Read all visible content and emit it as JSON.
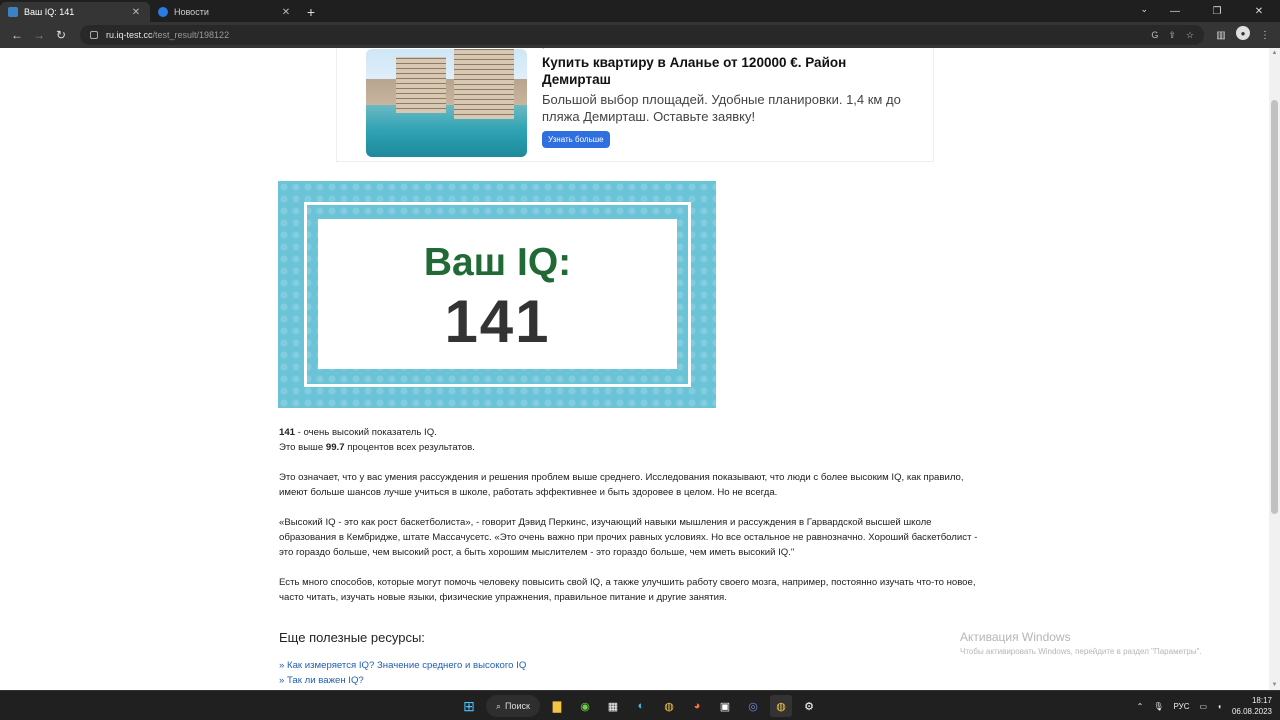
{
  "browser": {
    "tabs": [
      {
        "label": "Ваш IQ: 141",
        "active": true,
        "favicon_color": "#3b82c4"
      },
      {
        "label": "Новости",
        "active": false,
        "favicon_color": "#2a7be4"
      }
    ],
    "url_host": "ru.iq-test.cc",
    "url_path": "/test_result/198122"
  },
  "ad": {
    "title": "Купить квартиру в Аланье от 120000 €. Район Демирташ",
    "description": "Большой выбор площадей. Удобные планировки. 1,4 км до пляжа Демирташ. Оставьте заявку!",
    "button_label": "Узнать больше"
  },
  "result": {
    "label": "Ваш IQ:",
    "value": "141"
  },
  "article": {
    "p1_score": "141",
    "p1_text": " - очень высокий показатель IQ.",
    "p1_line2_prefix": "Это выше ",
    "p1_percent": "99.7",
    "p1_line2_suffix": " процентов всех результатов.",
    "p2": "Это означает, что у вас умения рассуждения и решения проблем выше среднего. Исследования показывают, что люди с более высоким IQ, как правило, имеют больше шансов лучше учиться в школе, работать эффективнее и быть здоровее в целом. Но не всегда.",
    "p3": "«Высокий IQ - это как рост баскетболиста», - говорит Дэвид Перкинс, изучающий навыки мышления и рассуждения в Гарвардской высшей школе образования в Кембридже, штате Массачусетс. «Это очень важно при прочих равных условиях. Но все остальное не равнозначно. Хороший баскетболист - это гораздо больше, чем высокий рост, а быть хорошим мыслителем - это гораздо больше, чем иметь высокий IQ.\"",
    "p4": "Есть много способов, которые могут помочь человеку повысить свой IQ, а также улучшить работу своего мозга, например, постоянно изучать что-то новое, часто читать, изучать новые языки, физические упражнения, правильное питание и другие занятия."
  },
  "resources": {
    "title": "Еще полезные ресурсы:",
    "links": [
      "» Как измеряется IQ? Значение среднего и высокого IQ",
      "» Так ли важен IQ?"
    ]
  },
  "watermark": {
    "line1": "Активация Windows",
    "line2": "Чтобы активировать Windows, перейдите в раздел \"Параметры\"."
  },
  "taskbar": {
    "search_label": "Поиск",
    "lang": "РУС",
    "time": "18:17",
    "date": "06.08.2023"
  }
}
